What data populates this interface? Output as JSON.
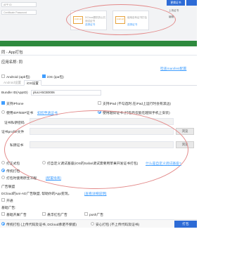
{
  "topbar": {
    "appid_input": "APP ID",
    "cert_password_input": "Certificate Password",
    "card1": {
      "name": "Android",
      "desc": "DCloud提供的公共测试证书",
      "link": "选择证书"
    },
    "card2": {
      "name": "Android",
      "desc": "使用自有证书打包",
      "link": "选择证书"
    },
    "primary_button": "更换证书",
    "side_text_1": "上传证书",
    "side_text_2": "编辑"
  },
  "page": {
    "header": "同 - App打包",
    "app_name_label": "应用名称: 同",
    "manifest_link": "检查manifest配置",
    "platform": {
      "android": {
        "label": "Android (apk包)",
        "checked": false
      },
      "ios": {
        "label": "iOS (ipa包)",
        "checked": true
      }
    },
    "tabs": [
      {
        "label": "Android设置",
        "active": false
      },
      {
        "label": "iOS设置",
        "active": true
      }
    ],
    "bundle_label": "Bundle ID(AppID)",
    "bundle_value": "plus.H5CB0006",
    "iphone_support": {
      "label": "支持iPhone",
      "checked": true
    },
    "ipad_support": {
      "label": "支持iPad (不勾选时,在iPad上运行时会有黑边)",
      "checked": false
    },
    "cert_mode": {
      "own": {
        "label": "使用IDP/EBP证书",
        "link": "如何申请证书",
        "checked": false
      },
      "jailbreak": {
        "label": "使用越狱证书 (打包后仅能在越狱手机上安装)",
        "checked": true
      }
    },
    "fields": {
      "private_key_label": "证书私钥密码",
      "profile_label": "证书profile文件",
      "private_cert_label": "私钥证书",
      "browse": "浏览"
    },
    "build_type": {
      "formal": {
        "label": "打正式包",
        "checked": false
      },
      "custom_debug": {
        "label": "打自定义调试基座(iOS的Safari调试需要用苹果开发证书打包)",
        "checked": false
      },
      "custom_debug_link": "什么是自定义调试基座?"
    },
    "traditional_pack": {
      "label": "传统打包",
      "checked": true
    },
    "alt_option": "打包时使用原生工程",
    "alt_link": "[配置指南]",
    "ads_title": "广告联盟",
    "ads_desc": "DCloud的uni-AD广告联盟, 帮助你的App变现。",
    "ads_link": "[查看详细说明]",
    "ads_option": "开通",
    "basic_ads": "基础广告:",
    "ad_items": [
      {
        "label": "基础开屏广告",
        "checked": false
      },
      {
        "label": "悬浮红包广告",
        "checked": false
      },
      {
        "label": "push广告",
        "checked": false
      }
    ],
    "bottom": {
      "option1": "传统打包 (上传代码及证书, DCloud承诺不保留)",
      "option2": "安心打包 (不上传代码及证书)",
      "pack_button": "打包"
    }
  }
}
